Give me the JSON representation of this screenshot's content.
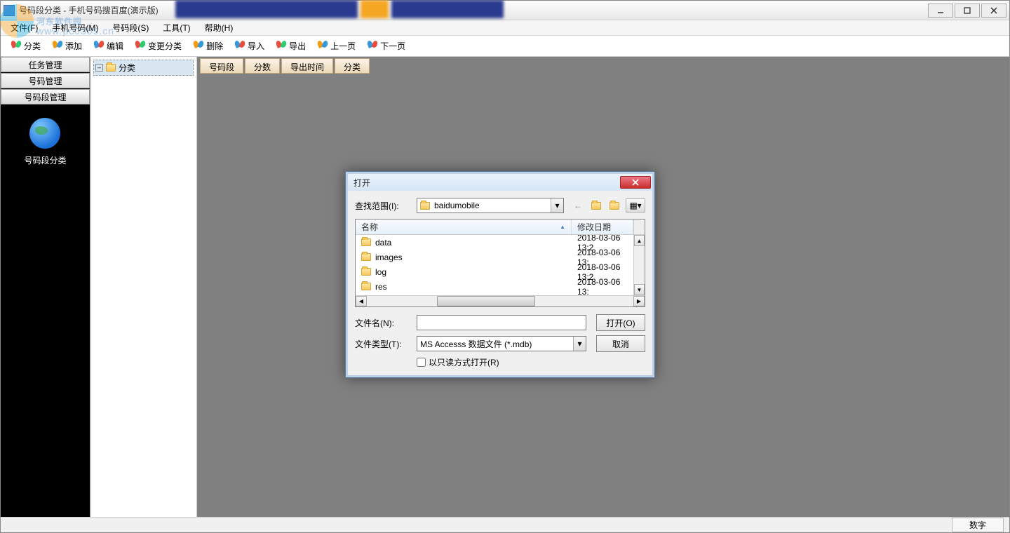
{
  "window": {
    "title": "号码段分类 - 手机号码搜百度(演示版)"
  },
  "watermark": {
    "text": "河东软件园",
    "sub": "www.pc0359.cn"
  },
  "menubar": [
    {
      "label": "文件(F)"
    },
    {
      "label": "手机号码(M)"
    },
    {
      "label": "号码段(S)"
    },
    {
      "label": "工具(T)"
    },
    {
      "label": "帮助(H)"
    }
  ],
  "toolbar": [
    {
      "label": "分类"
    },
    {
      "label": "添加"
    },
    {
      "label": "编辑"
    },
    {
      "label": "变更分类"
    },
    {
      "label": "删除"
    },
    {
      "label": "导入"
    },
    {
      "label": "导出"
    },
    {
      "label": "上一页"
    },
    {
      "label": "下一页"
    }
  ],
  "sidepanel": {
    "tabs": [
      "任务管理",
      "号码管理",
      "号码段管理"
    ],
    "item_label": "号码段分类"
  },
  "tree": {
    "root": "分类"
  },
  "data_tabs": [
    "号码段",
    "分数",
    "导出时间",
    "分类"
  ],
  "statusbar": {
    "right": "数字"
  },
  "dialog": {
    "title": "打开",
    "lookin_label": "查找范围(I):",
    "lookin_value": "baidumobile",
    "columns": {
      "name": "名称",
      "date": "修改日期"
    },
    "files": [
      {
        "name": "data",
        "date": "2018-03-06 13:2"
      },
      {
        "name": "images",
        "date": "2018-03-06 13:"
      },
      {
        "name": "log",
        "date": "2018-03-06 13:2"
      },
      {
        "name": "res",
        "date": "2018-03-06 13:"
      }
    ],
    "filename_label": "文件名(N):",
    "filename_value": "",
    "filetype_label": "文件类型(T):",
    "filetype_value": "MS Accesss 数据文件 (*.mdb)",
    "readonly_label": "以只读方式打开(R)",
    "open_btn": "打开(O)",
    "cancel_btn": "取消"
  }
}
